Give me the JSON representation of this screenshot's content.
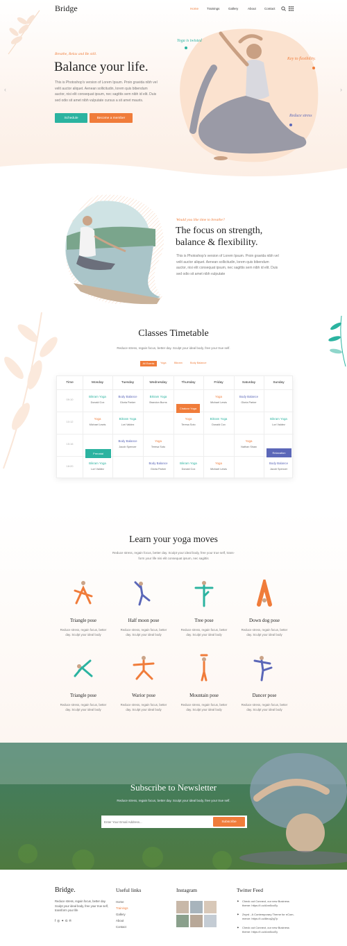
{
  "header": {
    "logo": "Bridge",
    "nav": [
      "Home",
      "Trainings",
      "Gallery",
      "About",
      "Contact"
    ]
  },
  "hero": {
    "eyebrow": "Breathe, Relax and Be still.",
    "title": "Balance your life.",
    "body": "This is Photoshop's version of Lorem Ipsum. Proin gravida nibh vel velit auctor aliquet. Aenean sollicitudin, lorem quis bibendum auctor, nisi elit consequat ipsum, nec sagittis sem nibh id elit. Duis sed odio sit amet nibh vulputate cursus a sit amet mauris.",
    "btn_primary": "Schedule",
    "btn_secondary": "Become a member",
    "tags": [
      "Yoga is twisted",
      "Key to flexibility.",
      "Reduce stress"
    ]
  },
  "focus": {
    "eyebrow": "Would you like time to breathe?",
    "title_line1": "The focus on strength,",
    "title_line2": "balance & flexibility.",
    "body": "This is Photoshop's version of Lorem Ipsum. Proin gravida nibh vel velit auctor aliquet. Aenean sollicitudin, lorem quis bibendum auctor, nisi elit consequat ipsum, nec sagittis sem nibh id elit. Duis sed odio sit amet nibh vulputate"
  },
  "timetable": {
    "title": "Classes Timetable",
    "subtitle": "Reduce stress, regain focus, better day. Sculpt your ideal body, free your true self.",
    "filters": [
      "All Events",
      "Yoga",
      "Bikram",
      "Body Balance"
    ],
    "days": [
      "Time",
      "Monday",
      "Tuesday",
      "Wednesday",
      "Thursday",
      "Friday",
      "Saturday",
      "Sunday"
    ],
    "times": [
      "09:10",
      "10:12",
      "15:16",
      "18:20"
    ],
    "rows": [
      [
        {
          "t": "Bikram Yoga",
          "s": "Donald Cox",
          "c": "#2bb3a0"
        },
        {
          "t": "Body Balance",
          "s": "Gloria Parker",
          "c": "#5b67b8"
        },
        {
          "t": "Bikram Yoga",
          "s": "Brandon Burns",
          "c": "#2bb3a0"
        },
        null,
        {
          "t": "Yoga",
          "s": "Michael Lewis",
          "c": "#f07c3a"
        },
        {
          "t": "Body Balance",
          "s": "Gloria Parker",
          "c": "#5b67b8"
        },
        null
      ],
      [
        {
          "t": "Yoga",
          "s": "Michael Lewis",
          "c": "#f07c3a"
        },
        {
          "t": "Bikram Yoga",
          "s": "Lori Valdez",
          "c": "#2bb3a0"
        },
        null,
        {
          "t": "Yoga",
          "s": "Teresa Soto",
          "c": "#f07c3a"
        },
        {
          "t": "Bikram Yoga",
          "s": "Donald Cox",
          "c": "#2bb3a0"
        },
        null,
        {
          "t": "Bikram Yoga",
          "s": "Lori Valdez",
          "c": "#2bb3a0"
        }
      ],
      [
        null,
        {
          "t": "Body Balance",
          "s": "Jacob Spencer",
          "c": "#5b67b8"
        },
        {
          "t": "Yoga",
          "s": "Teresa Soto",
          "c": "#f07c3a"
        },
        null,
        null,
        {
          "t": "Yoga",
          "s": "Nathan Shaw",
          "c": "#f07c3a"
        },
        null
      ],
      [
        {
          "t": "Bikram Yoga",
          "s": "Lori Valdez",
          "c": "#2bb3a0"
        },
        null,
        {
          "t": "Body Balance",
          "s": "Gloria Parker",
          "c": "#5b67b8"
        },
        {
          "t": "Bikram Yoga",
          "s": "Donald Cox",
          "c": "#2bb3a0"
        },
        {
          "t": "Yoga",
          "s": "Michael Lewis",
          "c": "#f07c3a"
        },
        null,
        {
          "t": "Body Balance",
          "s": "Jacob Spencer",
          "c": "#5b67b8"
        }
      ]
    ],
    "highlights": [
      "Chakrar Yoga",
      "Prenatal",
      "Relaxation"
    ]
  },
  "moves": {
    "title": "Learn your yoga moves",
    "subtitle_line1": "Reduce stress, regain focus, better day. Sculpt your ideal body, free your true self, trans-",
    "subtitle_line2": "form your life nisi elit consequat ipsum, nec sagittis",
    "poses": [
      "Triangle pose",
      "Half moon pose",
      "Tree pose",
      "Down dog pose",
      "Triangle pose",
      "Warior pose",
      "Mountain pose",
      "Dancer pose"
    ],
    "desc_line1": "Reduce stress, regain focus, better",
    "desc_line2": "day. Sculpt your ideal body"
  },
  "newsletter": {
    "title": "Subscribe to Newsletter",
    "subtitle": "Reduce stress, regain focus, better day. Sculpt your ideal body, free your true self.",
    "placeholder": "Enter Your Email Address...",
    "button": "Subscribe"
  },
  "footer": {
    "logo": "Bridge.",
    "about_line1": "Reduce stress, regain focus, better day.",
    "about_line2": "Sculpt your ideal body, free your true self,",
    "about_line3": "transform your life",
    "useful_title": "Useful links",
    "links": [
      "Home",
      "Trainings",
      "Gallery",
      "About",
      "Contact"
    ],
    "instagram_title": "Instagram",
    "twitter_title": "Twitter Feed",
    "tweets": [
      [
        "Check out Connect, our new Business",
        "theme: https://t.co/Ann5ocEy"
      ],
      [
        "Zeyrd - A Contemporary Theme for eCom-",
        "merce: https://t.co/8eoq2yj7p"
      ],
      [
        "Check out Connect, our new Business",
        "theme: https://t.co/Ann5ocEy"
      ]
    ]
  },
  "colors": {
    "accent": "#f07c3a",
    "teal": "#2bb3a0",
    "indigo": "#5b67b8"
  }
}
